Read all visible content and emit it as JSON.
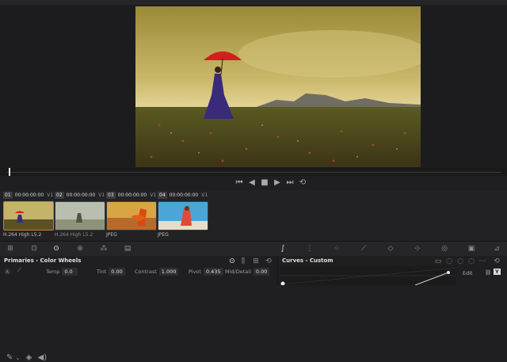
{
  "clips": [
    {
      "num": "01",
      "timecode": "00:00:00:00",
      "track": "V1",
      "format": "H.264 High L5.2"
    },
    {
      "num": "02",
      "timecode": "00:00:00:00",
      "track": "V1",
      "format": "H.264 High L5.2"
    },
    {
      "num": "03",
      "timecode": "00:00:00:00",
      "track": "V1",
      "format": "JPEG"
    },
    {
      "num": "04",
      "timecode": "00:00:00:00",
      "track": "V1",
      "format": "JPEG"
    }
  ],
  "primaries": {
    "title": "Primaries - Color Wheels",
    "temp_label": "Temp",
    "temp_value": "0.0",
    "tint_label": "Tint",
    "tint_value": "0.00",
    "contrast_label": "Contrast",
    "contrast_value": "1.000",
    "pivot_label": "Pivot",
    "pivot_value": "0.435",
    "middetail_label": "Mid/Detail",
    "middetail_value": "0.00"
  },
  "curves": {
    "title": "Curves - Custom",
    "edit_label": "Edit",
    "channel_label": "Y"
  },
  "colors": {
    "accent": "#d07a2a",
    "panel": "#1f1f21"
  }
}
